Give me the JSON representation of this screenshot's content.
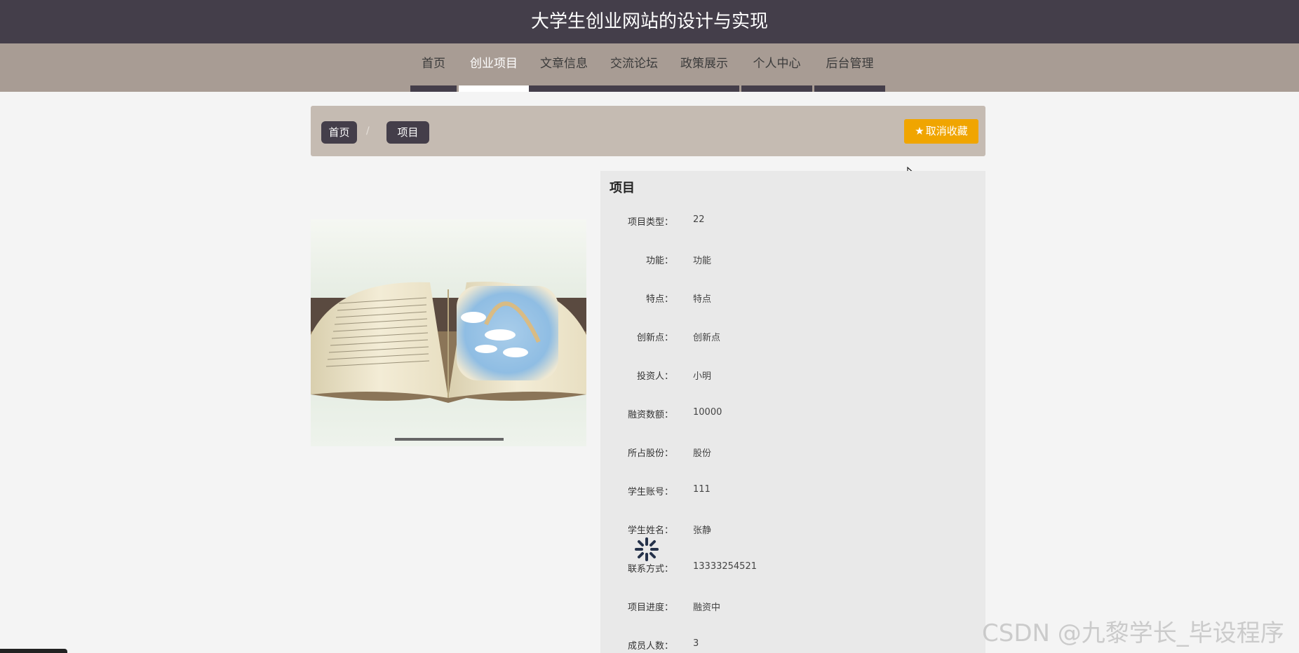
{
  "header": {
    "title": "大学生创业网站的设计与实现"
  },
  "nav": {
    "items": [
      {
        "label": "首页"
      },
      {
        "label": "创业项目"
      },
      {
        "label": "文章信息"
      },
      {
        "label": "交流论坛"
      },
      {
        "label": "政策展示"
      },
      {
        "label": "个人中心"
      },
      {
        "label": "后台管理"
      }
    ],
    "active_index": 1
  },
  "breadcrumb": {
    "home": "首页",
    "separator": "/",
    "current": "项目"
  },
  "actions": {
    "unfavorite": "取消收藏",
    "unfavorite_icon": "star-icon",
    "accent_color": "#f0a500"
  },
  "detail": {
    "title": "项目",
    "fields": [
      {
        "label": "项目类型：",
        "value": "22"
      },
      {
        "label": "功能：",
        "value": "功能"
      },
      {
        "label": "特点：",
        "value": "特点"
      },
      {
        "label": "创新点：",
        "value": "创新点"
      },
      {
        "label": "投资人：",
        "value": "小明"
      },
      {
        "label": "融资数额：",
        "value": "10000"
      },
      {
        "label": "所占股份：",
        "value": "股份"
      },
      {
        "label": "学生账号：",
        "value": "111"
      },
      {
        "label": "学生姓名：",
        "value": "张静"
      },
      {
        "label": "联系方式：",
        "value": "13333254521"
      },
      {
        "label": "项目进度：",
        "value": "融资中"
      },
      {
        "label": "成员人数：",
        "value": "3"
      }
    ]
  },
  "watermark": "CSDN @九黎学长_毕设程序",
  "colors": {
    "topbar": "#443e4a",
    "navbar": "#a89c94",
    "panel": "#c5bbb2"
  }
}
